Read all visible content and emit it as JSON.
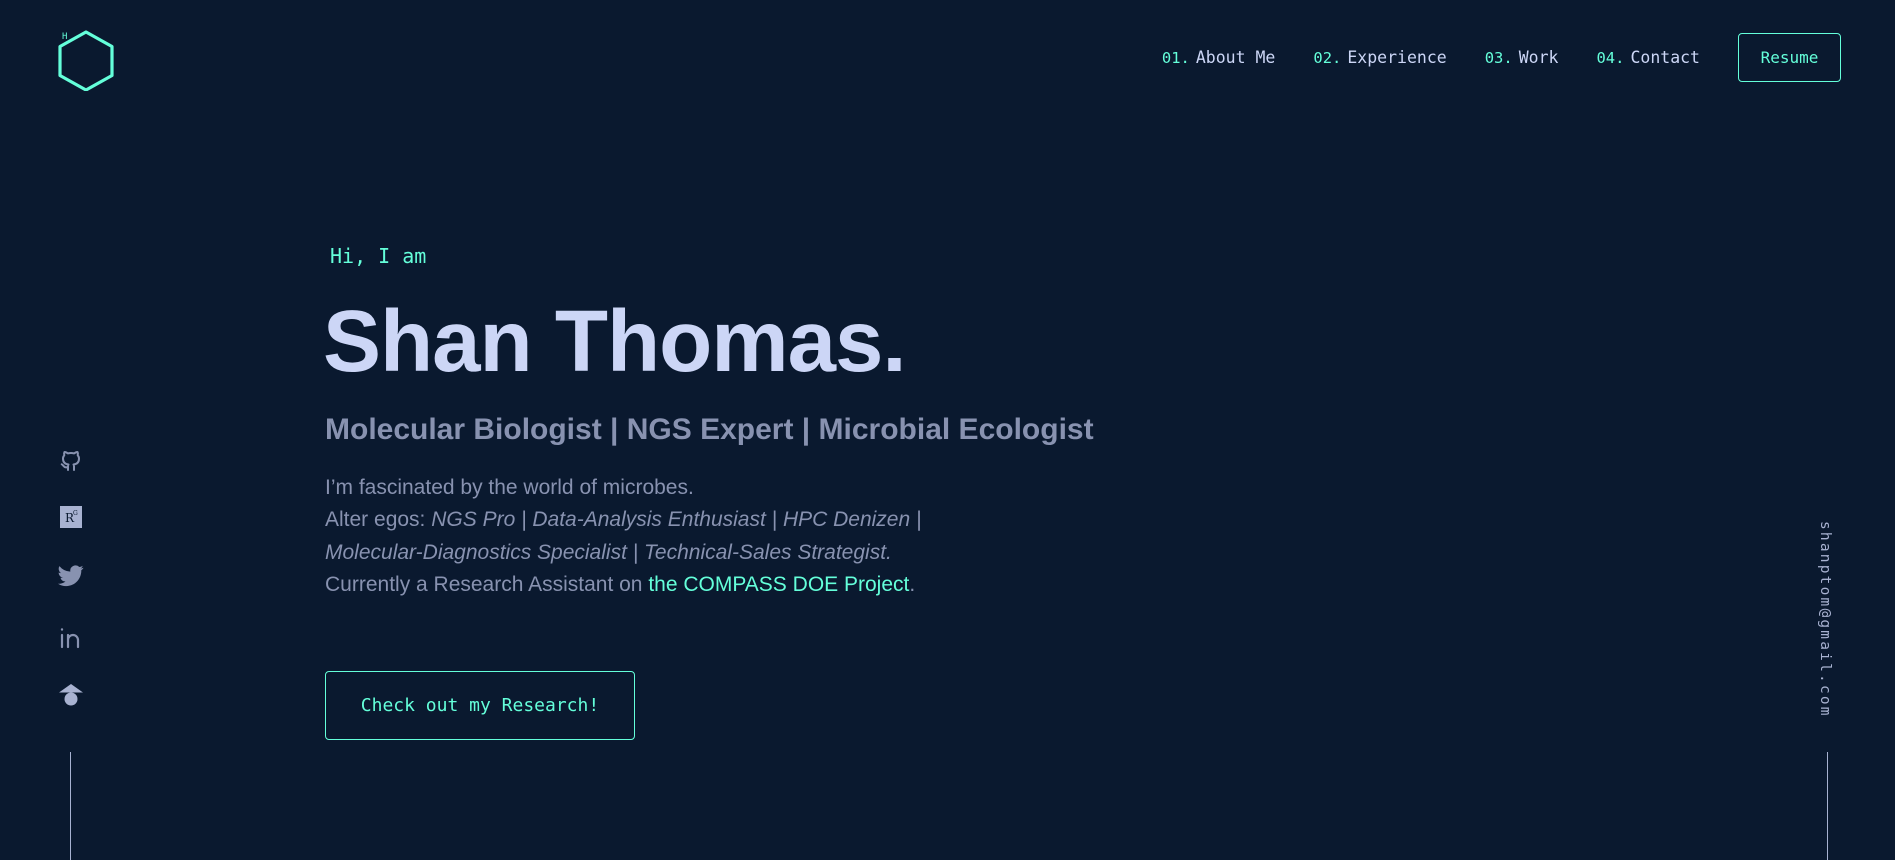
{
  "header": {
    "logo_letter": "H",
    "logo_icon": "hexagon-logo-icon",
    "nav": [
      {
        "num": "01.",
        "label": "About Me"
      },
      {
        "num": "02.",
        "label": "Experience"
      },
      {
        "num": "03.",
        "label": "Work"
      },
      {
        "num": "04.",
        "label": "Contact"
      }
    ],
    "resume_label": "Resume"
  },
  "hero": {
    "greeting": "Hi, I am",
    "name": "Shan Thomas.",
    "subtitle": "Molecular Biologist | NGS Expert | Microbial Ecologist",
    "bio_line1": "I’m fascinated by the world of microbes.",
    "bio_line2_prefix": "Alter egos: ",
    "bio_line2_italic": "NGS Pro | Data-Analysis Enthusiast | HPC Denizen |",
    "bio_line3_italic": "Molecular-Diagnostics Specialist | Technical-Sales Strategist.",
    "bio_line4_prefix": "Currently a Research Assistant on ",
    "bio_line4_link": "the COMPASS DOE Project",
    "bio_line4_suffix": ".",
    "cta_label": "Check out my Research!"
  },
  "social": {
    "icons": [
      "github-icon",
      "researchgate-icon",
      "twitter-icon",
      "linkedin-icon",
      "google-scholar-icon"
    ],
    "researchgate_text": "R"
  },
  "email": "shanptom@gmail.com",
  "colors": {
    "background": "#0a192f",
    "accent": "#64ffda",
    "heading": "#ccd6f6",
    "body_text": "#8892b0"
  }
}
